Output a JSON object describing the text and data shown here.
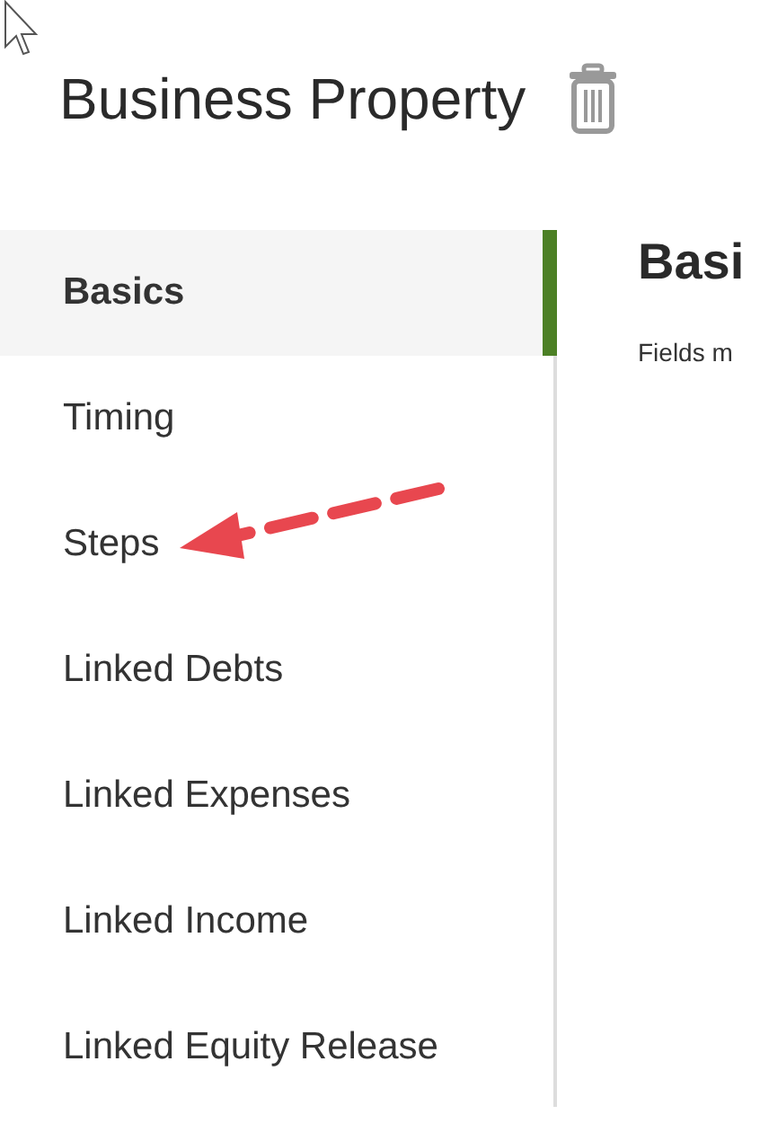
{
  "page": {
    "title": "Business Property"
  },
  "sidebar": {
    "items": [
      {
        "label": "Basics",
        "selected": true
      },
      {
        "label": "Timing",
        "selected": false
      },
      {
        "label": "Steps",
        "selected": false
      },
      {
        "label": "Linked Debts",
        "selected": false
      },
      {
        "label": "Linked Expenses",
        "selected": false
      },
      {
        "label": "Linked Income",
        "selected": false
      },
      {
        "label": "Linked Equity Release",
        "selected": false
      }
    ]
  },
  "content": {
    "heading": "Basi",
    "note": "Fields m"
  }
}
